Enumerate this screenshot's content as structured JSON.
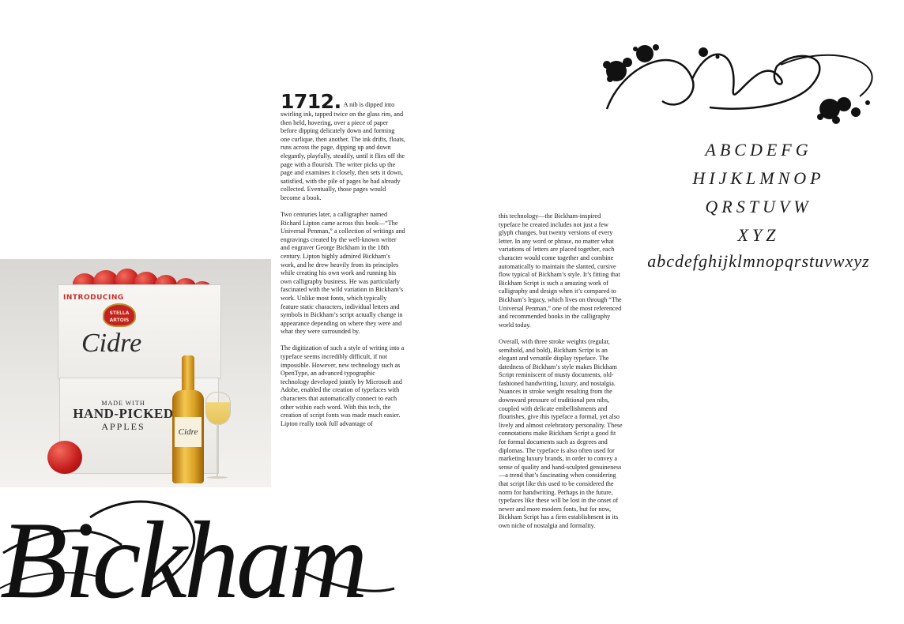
{
  "article": {
    "year": "1712.",
    "left_column": [
      "A nib is dipped into swirling ink, tapped twice on the glass rim, and then held, hovering, over a piece of paper before dipping delicately down and forming one curlique, then another. The ink drifts, floats, runs across the page, dipping up and down elegantly, playfully, steadily, until it flies off the page with a flourish. The writer picks up the page and examines it closely, then sets it down, satisfied, with the pile of pages he had already collected. Eventually, those pages would become a book.",
      "Two centuries later, a calligrapher named Richard Lipton came across this book—“The Universal Penman,” a collection of writings and engravings created by the well-known writer and engraver George Bickham in the 18th century. Lipton highly admired Bickham’s work, and he drew heavily from its principles while creating his own work and running his own calligraphy business. He was particularly fascinated with the wild variation in Bickham’s work. Unlike most fonts, which typically feature static characters, individual letters and symbols in Bickham’s script actually change in appearance depending on where they were and what they were surrounded by.",
      "The digitization of such a style of writing into a typeface seems incredibly difficult, if not impossible. However, new technology such as OpenType, an advanced typographic technology developed jointly by Microsoft and Adobe, enabled the creation of typefaces with characters that automatically connect to each other within each word. With this tech, the creation of script fonts was made much easier. Lipton really took full advantage of"
    ],
    "right_column": [
      "this technology—the Bickham-inspired typeface he created includes not just a few glyph changes, but twenty versions of every letter. In any word or phrase, no matter what variations of letters are placed together, each character would come together and combine automatically to maintain the slanted, cursive flow typical of Bickham’s style. It’s fitting that Bickham Script is such a amazing work of calligraphy and design when it’s compared to Bickham’s legacy, which lives on through “The Universal Penman,” one of the most referenced and recommended books in the calligraphy world today.",
      "Overall, with three stroke weights (regular, semibold, and bold), Bickham Script is an elegant and versatile display typeface. The datedness of Bickham’s style makes Bickham Script reminiscent of musty documents, old-fashioned handwriting, luxury, and nostalgia. Nuances in stroke weight resulting from the downward pressure of traditional pen nibs, coupled with delicate embellishments and flourishes, give this typeface a formal, yet also lively and almost celebratory personality. These connotations make Bickham Script a good fit for formal documents such as degrees and diplomas. The typeface is also often used for marketing luxury brands, in order to convey a sense of quality and hand-sculpted genuineness—a trend that’s fascinating when considering that script like this used to be considered the norm for handwriting. Perhaps in the future, typefaces like these will be lost in the onset of newer and more modern fonts, but for now, Bickham Script has a firm establishment in its own niche of nostalgia and formality."
    ]
  },
  "photo": {
    "introducing": "INTRODUCING",
    "brand_badge": "STELLA ARTOIS",
    "crate_word": "Cidre",
    "crate_small": "MADE WITH",
    "crate_big": "HAND-PICKED",
    "crate_mid": "APPLES",
    "bottle_label": "Cidre"
  },
  "wordmark": "Bickham",
  "specimen": {
    "upper_1": "ABCDEFG",
    "upper_2": "HIJKLMNOP",
    "upper_3": "QRSTUVW",
    "upper_4": "XYZ",
    "lower": "abcdefghijklmnopqrstuvwxyz"
  }
}
